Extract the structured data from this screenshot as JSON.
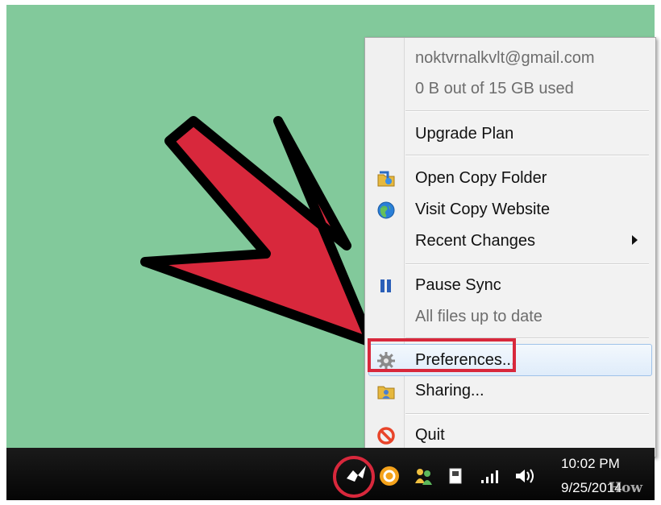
{
  "menu": {
    "account_email": "noktvrnalkvlt@gmail.com",
    "storage_usage": "0 B out of 15 GB used",
    "upgrade_plan": "Upgrade Plan",
    "open_copy_folder": "Open Copy Folder",
    "visit_copy_website": "Visit Copy Website",
    "recent_changes": "Recent Changes",
    "pause_sync": "Pause Sync",
    "sync_status": "All files up to date",
    "preferences": "Preferences...",
    "sharing": "Sharing...",
    "quit": "Quit"
  },
  "taskbar": {
    "clock_time": "10:02 PM",
    "clock_date": "9/25/2014",
    "watermark": "How"
  },
  "icons": {
    "copy_tray": "copy-tray-icon",
    "open_folder": "folder-icon",
    "website": "globe-icon",
    "pause": "pause-icon",
    "preferences": "gear-icon",
    "sharing": "shared-folder-icon",
    "quit": "quit-icon"
  },
  "colors": {
    "desktop": "#82c99b",
    "annotation_red": "#d8283c",
    "menu_background": "#f2f2f2",
    "hover_border": "#9fc2e9"
  }
}
